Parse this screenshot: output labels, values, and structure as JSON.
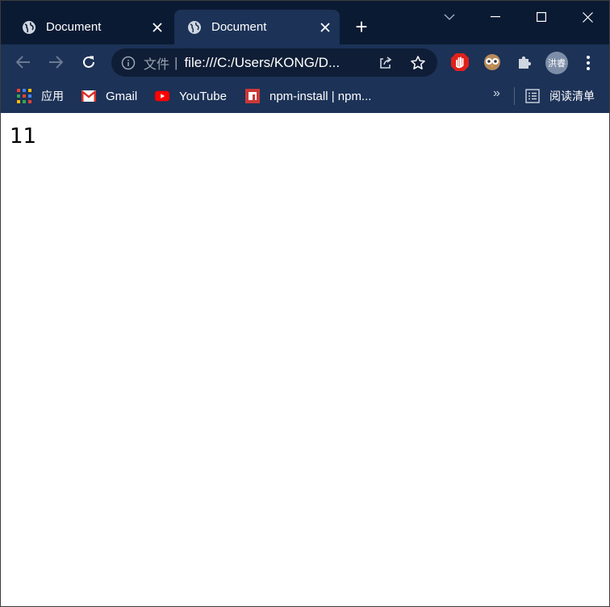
{
  "tabs": [
    {
      "title": "Document",
      "active": false
    },
    {
      "title": "Document",
      "active": true
    }
  ],
  "new_tab_symbol": "+",
  "window_controls": {
    "icons": [
      "chevron-down-icon",
      "minimize-icon",
      "maximize-icon",
      "close-icon"
    ]
  },
  "omnibox": {
    "scheme_label": "文件",
    "separator": "|",
    "url": "file:///C:/Users/KONG/D..."
  },
  "profile": {
    "avatar_text": "洪睿"
  },
  "bookmarks": [
    {
      "label": "应用",
      "icon": "apps-grid-icon"
    },
    {
      "label": "Gmail",
      "icon": "gmail-icon"
    },
    {
      "label": "YouTube",
      "icon": "youtube-icon"
    },
    {
      "label": "npm-install | npm...",
      "icon": "npm-icon"
    }
  ],
  "bookmarks_overflow": "»",
  "reading_list": {
    "label": "阅读清单",
    "icon": "reading-list-icon"
  },
  "page": {
    "text": "11"
  },
  "colors": {
    "tabstrip_bg": "#0b1a33",
    "toolbar_bg": "#1c3257",
    "omnibox_bg": "#0f1e36",
    "stop_ext_red": "#e0201b"
  }
}
